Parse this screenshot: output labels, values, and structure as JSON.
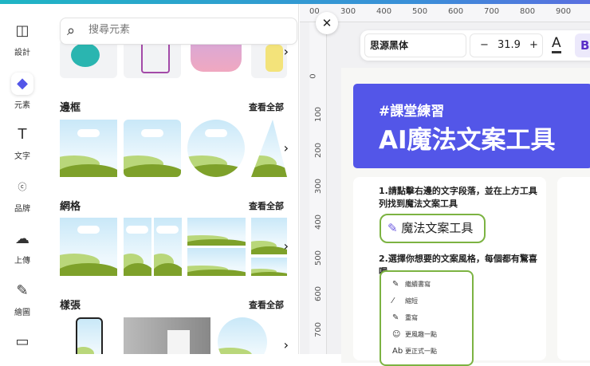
{
  "sidebar": {
    "items": [
      {
        "label": "設計",
        "icon": "layout-icon"
      },
      {
        "label": "元素",
        "icon": "shapes-icon"
      },
      {
        "label": "文字",
        "icon": "text-icon"
      },
      {
        "label": "品牌",
        "icon": "brand-icon"
      },
      {
        "label": "上傳",
        "icon": "upload-cloud-icon"
      },
      {
        "label": "繪圖",
        "icon": "draw-icon"
      },
      {
        "label": "",
        "icon": "folder-icon"
      }
    ]
  },
  "panel": {
    "search_placeholder": "搜尋元素",
    "sections": [
      {
        "title": "邊框",
        "see_all": "查看全部"
      },
      {
        "title": "網格",
        "see_all": "查看全部"
      },
      {
        "title": "樣張",
        "see_all": "查看全部"
      }
    ]
  },
  "rulers": {
    "h": [
      "00",
      "300",
      "400",
      "500",
      "600",
      "700",
      "800",
      "900"
    ],
    "v": [
      "0",
      "100",
      "200",
      "300",
      "400",
      "500",
      "600",
      "700"
    ]
  },
  "toolbar": {
    "font": "思源黑体",
    "minus": "−",
    "size": "31.9",
    "plus": "+",
    "color_label": "A",
    "bold_label": "B"
  },
  "canvas": {
    "tag": "#課堂練習",
    "title": "AI魔法文案工具",
    "step1": "1.請點擊右邊的文字段落，並在上方工具列找到魔法文案工具",
    "magic_button": "魔法文案工具",
    "step2": "2.選擇你想要的文案風格，每個都有驚喜喔",
    "menu": [
      {
        "icon": "✎",
        "label": "繼續書寫"
      },
      {
        "icon": "⁄",
        "label": "縮短"
      },
      {
        "icon": "✎",
        "label": "重寫"
      },
      {
        "icon": "☺",
        "label": "更風趣一點"
      },
      {
        "icon": "Ab",
        "label": "更正式一點"
      }
    ]
  },
  "colors": {
    "accent": "#5356e8",
    "green": "#7cb342"
  }
}
